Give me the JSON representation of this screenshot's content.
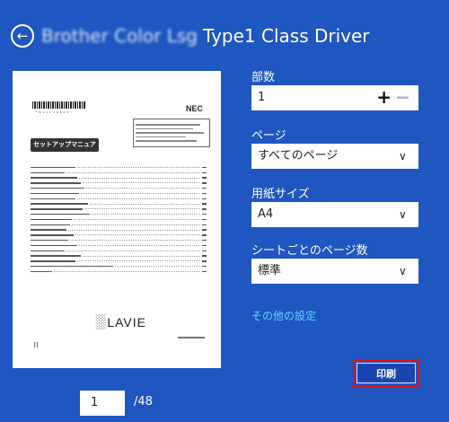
{
  "header": {
    "back_icon": "arrow-left-circle-icon",
    "printer_name_obscured": "Brother Color Lsg",
    "title": "Type1 Class Driver"
  },
  "preview": {
    "document_title": "セットアップマニュアル",
    "logo": "NEC",
    "brand": "LAVIE",
    "current_page": "1",
    "total_pages": "/48"
  },
  "settings": {
    "copies": {
      "label": "部数",
      "value": "1",
      "plus": "+",
      "minus": "−"
    },
    "pages": {
      "label": "ページ",
      "value": "すべてのページ"
    },
    "paper_size": {
      "label": "用紙サイズ",
      "value": "A4"
    },
    "pages_per_sheet": {
      "label": "シートごとのページ数",
      "value": "標準"
    },
    "more_settings": "その他の設定"
  },
  "print_button": {
    "label": "印刷"
  },
  "colors": {
    "background": "#1f56c0",
    "accent_link": "#5fd3ff",
    "highlight_outline": "#e01010"
  }
}
